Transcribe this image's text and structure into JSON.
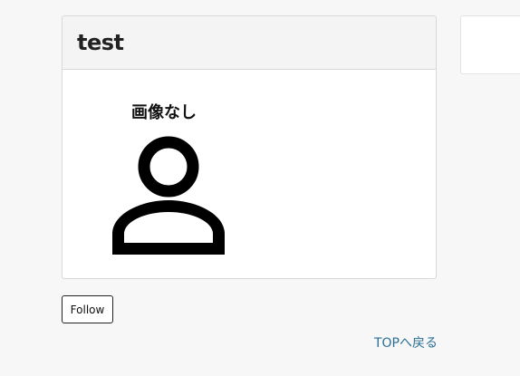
{
  "card": {
    "title": "test",
    "no_image_label": "画像なし",
    "placeholder_icon": "person-icon"
  },
  "actions": {
    "follow_label": "Follow",
    "back_to_top_label": "TOPへ戻る"
  },
  "colors": {
    "background": "#f7f7f7",
    "link": "#2a6f97",
    "card_header": "#f4f4f4"
  }
}
